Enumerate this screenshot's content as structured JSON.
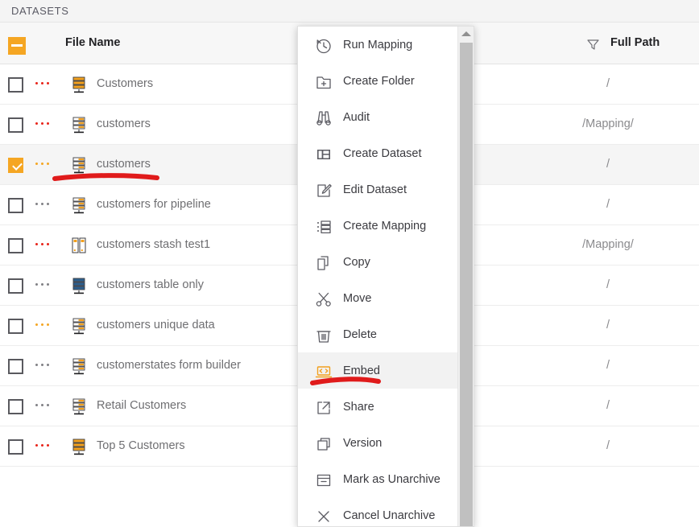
{
  "topbar": {
    "title": "DATASETS"
  },
  "grid": {
    "header": {
      "file_name": "File Name",
      "full_path": "Full Path",
      "select_all_state": "indeterminate",
      "filter_icon": "filter-icon"
    },
    "rows": [
      {
        "name": "Customers",
        "path": "/",
        "checked": false,
        "selected": false,
        "dots_color": "#e8241a",
        "icon": "database-orange-icon"
      },
      {
        "name": "customers",
        "path": "/Mapping/",
        "checked": false,
        "selected": false,
        "dots_color": "#e8241a",
        "icon": "database-grey-icon"
      },
      {
        "name": "customers",
        "path": "/",
        "checked": true,
        "selected": true,
        "dots_color": "#f5a623",
        "icon": "database-grey-icon"
      },
      {
        "name": "customers for pipeline",
        "path": "/",
        "checked": false,
        "selected": false,
        "dots_color": "#808085",
        "icon": "database-grey-icon"
      },
      {
        "name": "customers stash test1",
        "path": "/Mapping/",
        "checked": false,
        "selected": false,
        "dots_color": "#e8241a",
        "icon": "stash-icon"
      },
      {
        "name": "customers table only",
        "path": "/",
        "checked": false,
        "selected": false,
        "dots_color": "#808085",
        "icon": "database-blue-icon"
      },
      {
        "name": "customers unique data",
        "path": "/",
        "checked": false,
        "selected": false,
        "dots_color": "#f5a623",
        "icon": "database-grey-icon"
      },
      {
        "name": "customerstates form builder",
        "path": "/",
        "checked": false,
        "selected": false,
        "dots_color": "#808085",
        "icon": "database-grey-icon"
      },
      {
        "name": "Retail Customers",
        "path": "/",
        "checked": false,
        "selected": false,
        "dots_color": "#808085",
        "icon": "database-grey-icon"
      },
      {
        "name": "Top 5 Customers",
        "path": "/",
        "checked": false,
        "selected": false,
        "dots_color": "#e8241a",
        "icon": "database-orange-icon"
      }
    ]
  },
  "context_menu": {
    "items": [
      {
        "label": "Run Mapping",
        "icon": "history-clock-icon",
        "highlighted": false
      },
      {
        "label": "Create Folder",
        "icon": "folder-plus-icon",
        "highlighted": false
      },
      {
        "label": "Audit",
        "icon": "binoculars-icon",
        "highlighted": false
      },
      {
        "label": "Create Dataset",
        "icon": "dataset-grid-icon",
        "highlighted": false
      },
      {
        "label": "Edit Dataset",
        "icon": "pencil-square-icon",
        "highlighted": false
      },
      {
        "label": "Create Mapping",
        "icon": "mapping-list-icon",
        "highlighted": false
      },
      {
        "label": "Copy",
        "icon": "copy-icon",
        "highlighted": false
      },
      {
        "label": "Move",
        "icon": "scissors-icon",
        "highlighted": false
      },
      {
        "label": "Delete",
        "icon": "trash-icon",
        "highlighted": false
      },
      {
        "label": "Embed",
        "icon": "embed-code-icon",
        "highlighted": true
      },
      {
        "label": "Share",
        "icon": "share-arrow-icon",
        "highlighted": false
      },
      {
        "label": "Version",
        "icon": "version-layers-icon",
        "highlighted": false
      },
      {
        "label": "Mark as Unarchive",
        "icon": "archive-box-icon",
        "highlighted": false
      },
      {
        "label": "Cancel Unarchive",
        "icon": "close-x-icon",
        "highlighted": false
      }
    ],
    "scrollbar": {
      "arrow": "scroll-up-arrow-icon"
    }
  },
  "annotations": {
    "accent_color": "#f5a623",
    "marker_color": "#e01b1b",
    "strokes": [
      {
        "name": "underline-selected-dataset"
      },
      {
        "name": "underline-embed-menu-item"
      }
    ]
  }
}
